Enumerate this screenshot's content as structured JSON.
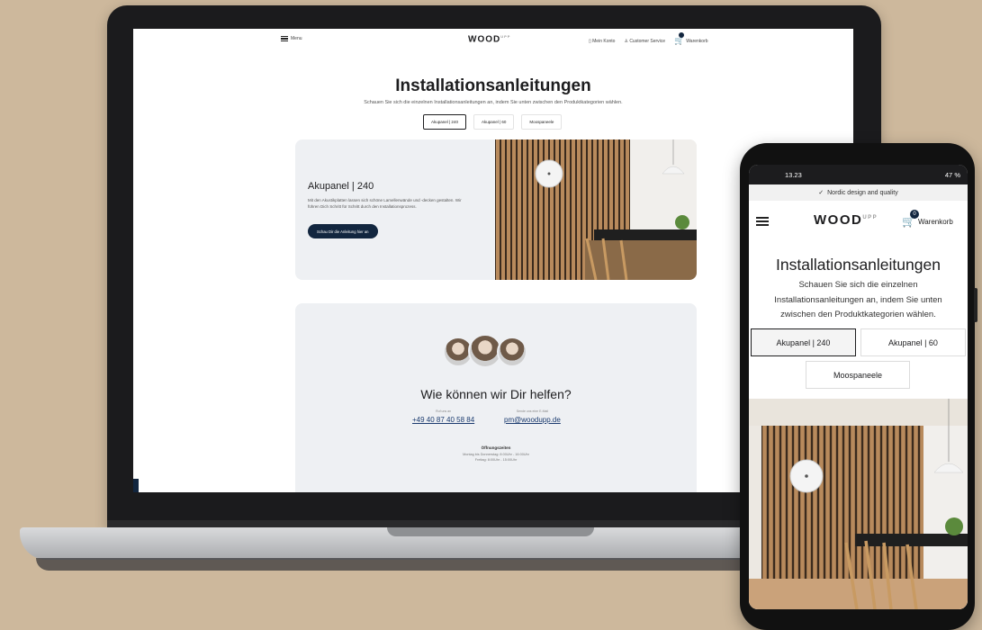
{
  "laptop": {
    "nav": {
      "menu_label": "Menu",
      "logo_text": "WOOD",
      "logo_suffix": "UPP",
      "login_label": "Mein Konto",
      "service_label": "Customer Service",
      "cart_label": "Warenkorb"
    },
    "page_title": "Installationsanleitungen",
    "page_subtitle": "Schauen Sie sich die einzelnen Installationsanleitungen an, indem Sie unten zwischen den Produktkategorien wählen.",
    "tabs": [
      {
        "label": "Akupanel | 240",
        "active": true
      },
      {
        "label": "Akupanel | 60",
        "active": false
      },
      {
        "label": "Moospaneele",
        "active": false
      }
    ],
    "card": {
      "title": "Akupanel | 240",
      "text": "Mit den Akustikplatten lassen sich schöne Lamellenwände und -decken gestalten. Wir führen Dich Schritt für Schritt durch den Installationsprozess.",
      "button_label": "Schau Dir die Anleitung hier an"
    },
    "help": {
      "title": "Wie können wir Dir helfen?",
      "phone_caption": "Ruf uns an",
      "phone": "+49 40 87 40 58 84",
      "email_caption": "Sende uns eine E-Mail",
      "email": "pm@woodupp.de",
      "hours_title": "Öffnungszeiten",
      "hours_line1": "Montag bis Donnerstag: 8:00Uhr - 16:00Uhr",
      "hours_line2": "Freitag: 8:00Uhr - 15:00Uhr"
    }
  },
  "phone": {
    "status": {
      "time": "13.23",
      "right": "47 %"
    },
    "banner_text": "Nordic design and quality",
    "nav": {
      "logo_text": "WOOD",
      "logo_suffix": "UPP",
      "cart_label": "Warenkorb",
      "cart_count": "0"
    },
    "page_title": "Installationsanleitungen",
    "page_subtitle": "Schauen Sie sich die einzelnen Installationsanleitungen an, indem Sie unten zwischen den Produktkategorien wählen.",
    "tabs": [
      {
        "label": "Akupanel | 240",
        "active": true
      },
      {
        "label": "Akupanel | 60",
        "active": false
      },
      {
        "label": "Moospaneele",
        "active": false
      }
    ]
  },
  "colors": {
    "background": "#cdb89c",
    "brand_navy": "#12263f",
    "card_bg": "#eef0f3",
    "wood": "#b88a5c"
  },
  "icons": [
    "hamburger-icon",
    "user-icon",
    "headset-icon",
    "cart-icon",
    "checkmark-icon",
    "clock-decor",
    "pendant-lamp"
  ]
}
